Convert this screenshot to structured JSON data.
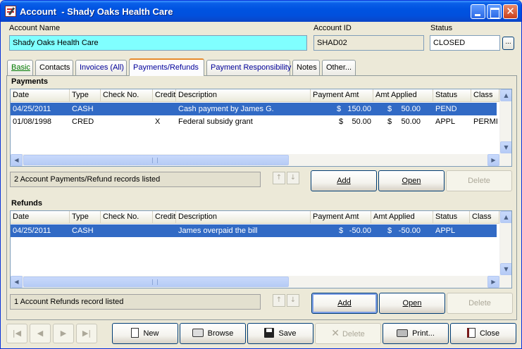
{
  "window": {
    "title": "Account  - Shady Oaks Health Care",
    "close_glyph": "✕"
  },
  "header": {
    "account_name_label": "Account Name",
    "account_name_value": "Shady Oaks Health Care",
    "account_id_label": "Account ID",
    "account_id_value": "SHAD02",
    "status_label": "Status",
    "status_value": "CLOSED",
    "status_button_label": "..."
  },
  "tabs": [
    {
      "label": "Basic"
    },
    {
      "label": "Contacts"
    },
    {
      "label": "Invoices (All)"
    },
    {
      "label": "Payments/Refunds"
    },
    {
      "label": "Payment Responsibility"
    },
    {
      "label": "Notes"
    },
    {
      "label": "Other..."
    }
  ],
  "payments": {
    "title": "Payments",
    "columns": [
      "Date",
      "Type",
      "Check No.",
      "Credit",
      "Description",
      "Payment Amt",
      "Amt Applied",
      "Status",
      "Class"
    ],
    "rows": [
      {
        "date": "04/25/2011",
        "type": "CASH",
        "check_no": "",
        "credit": "",
        "description": "Cash payment by James G.",
        "cur1": "$",
        "payment_amt": "150.00",
        "cur2": "$",
        "amt_applied": "50.00",
        "status": "PEND",
        "class": ""
      },
      {
        "date": "01/08/1998",
        "type": "CRED",
        "check_no": "",
        "credit": "X",
        "description": "Federal subsidy grant",
        "cur1": "$",
        "payment_amt": "50.00",
        "cur2": "$",
        "amt_applied": "50.00",
        "status": "APPL",
        "class": "PERMI"
      }
    ],
    "status_text": "2 Account Payments/Refund records listed",
    "add_label": "Add",
    "open_label": "Open",
    "delete_label": "Delete"
  },
  "refunds": {
    "title": "Refunds",
    "columns": [
      "Date",
      "Type",
      "Check No.",
      "Credit",
      "Description",
      "Payment Amt",
      "Amt Applied",
      "Status",
      "Class"
    ],
    "rows": [
      {
        "date": "04/25/2011",
        "type": "CASH",
        "check_no": "",
        "credit": "",
        "description": "James overpaid the bill",
        "cur1": "$",
        "payment_amt": "-50.00",
        "cur2": "$",
        "amt_applied": "-50.00",
        "status": "APPL",
        "class": ""
      }
    ],
    "status_text": "1 Account Refunds record listed",
    "add_label": "Add",
    "open_label": "Open",
    "delete_label": "Delete"
  },
  "scroll_glyphs": {
    "up": "▲",
    "down": "▼",
    "left": "◀",
    "right": "▶"
  },
  "move_glyphs": {
    "up": "↑",
    "down": "↓"
  },
  "nav_glyphs": {
    "first": "|◀",
    "prev": "◀",
    "next": "▶",
    "last": "▶|"
  },
  "toolbar": {
    "new_label": "New",
    "browse_label": "Browse",
    "save_label": "Save",
    "delete_label": "Delete",
    "delete_glyph": "✕",
    "print_label": "Print...",
    "close_label": "Close"
  }
}
